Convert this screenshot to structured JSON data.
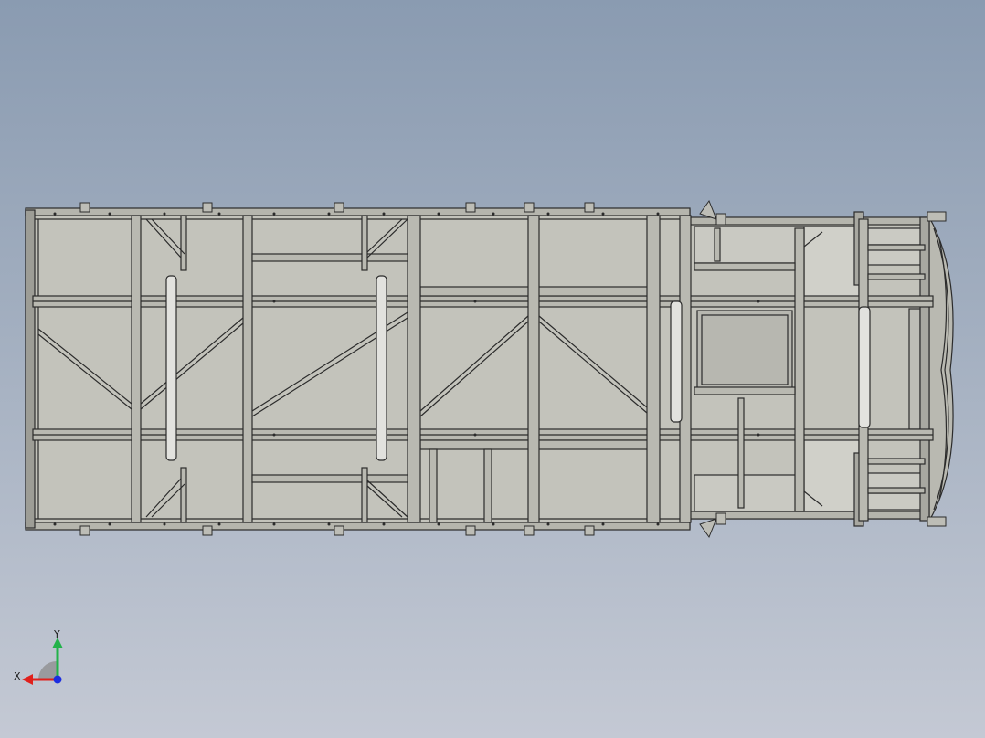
{
  "viewport": {
    "background_top": "#8a9bb1",
    "background_bottom": "#c4c9d4"
  },
  "model": {
    "fill_color": "#c3c3bb",
    "edge_color": "#2b2b2b",
    "tube_color": "#e2e2de"
  },
  "triad": {
    "x_label": "X",
    "y_label": "Y",
    "x_color": "#e0201c",
    "y_color": "#22b24a",
    "z_color": "#1c2ee0"
  }
}
